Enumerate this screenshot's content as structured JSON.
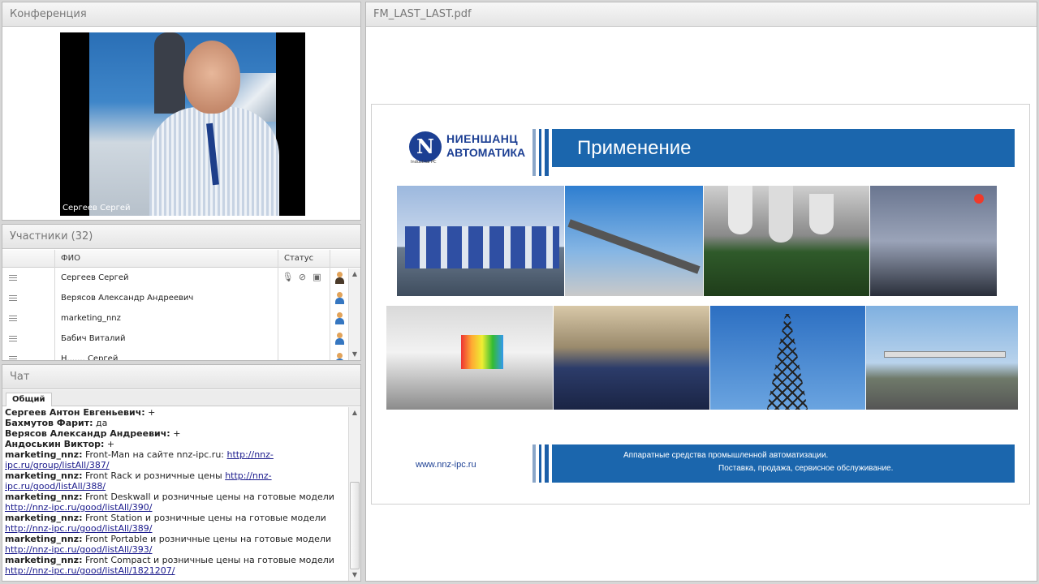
{
  "conference": {
    "title": "Конференция",
    "video_label": "Сергеев Сергей"
  },
  "participants": {
    "title": "Участники (32)",
    "col_name": "ФИО",
    "col_status": "Статус",
    "rows": [
      {
        "name": "Сергеев Сергей",
        "status_icons": [
          "mic-icon",
          "camera-icon",
          "screen-off-icon"
        ],
        "role_icon": "presenter-icon"
      },
      {
        "name": "Верясов Александр  Андреевич",
        "status_icons": [],
        "role_icon": "user-icon"
      },
      {
        "name": "marketing_nnz",
        "status_icons": [],
        "role_icon": "user-icon"
      },
      {
        "name": "Бабич Виталий",
        "status_icons": [],
        "role_icon": "user-icon"
      },
      {
        "name": "Н.......  Сергей",
        "status_icons": [],
        "role_icon": "user-icon"
      }
    ]
  },
  "chat": {
    "title": "Чат",
    "tab": "Общий",
    "messages": [
      {
        "author": "Сергеев Антон  Евгеньевич:",
        "text": " +",
        "link": ""
      },
      {
        "author": "Бахмутов Фарит:",
        "text": " да",
        "link": ""
      },
      {
        "author": "Верясов Александр  Андреевич:",
        "text": " +",
        "link": ""
      },
      {
        "author": "Андоськин Виктор:",
        "text": " +",
        "link": ""
      },
      {
        "author": "marketing_nnz:",
        "text": " Front-Man на сайте nnz-ipc.ru:  ",
        "link": "http://nnz-ipc.ru/group/listAll/387/"
      },
      {
        "author": "marketing_nnz:",
        "text": " Front Rack и розничные цены ",
        "link": "http://nnz-ipc.ru/good/listAll/388/"
      },
      {
        "author": "marketing_nnz:",
        "text": " Front Deskwall и розничные цены на готовые модели ",
        "link": "http://nnz-ipc.ru/good/listAll/390/"
      },
      {
        "author": "marketing_nnz:",
        "text": " Front Station и розничные цены на готовые модели ",
        "link": "http://nnz-ipc.ru/good/listAll/389/"
      },
      {
        "author": "marketing_nnz:",
        "text": " Front Portable и розничные цены на готовые модели ",
        "link": "http://nnz-ipc.ru/good/listAll/393/"
      },
      {
        "author": "marketing_nnz:",
        "text": " Front Compact и розничные цены на готовые модели ",
        "link": "http://nnz-ipc.ru/good/listAll/1821207/"
      }
    ]
  },
  "document": {
    "title": "FM_LAST_LAST.pdf",
    "slide": {
      "logo_line1": "НИЕНШАНЦ",
      "logo_line2": "АВТОМАТИКА",
      "logo_mark": "N",
      "logo_sub": "Industrial PC",
      "heading": "Применение",
      "website": "www.nnz-ipc.ru",
      "footer_line1": "Аппаратные средства промышленной автоматизации.",
      "footer_line2": "Поставка, продажа, сервисное обслуживание.",
      "photos": [
        "trucks",
        "monorail",
        "microscope-pcb",
        "railway-crossing",
        "control-room",
        "train-interior",
        "power-pylon",
        "highway-gantry"
      ]
    }
  },
  "colors": {
    "brand_blue": "#1b66ad",
    "logo_blue": "#1c3f93",
    "link": "#1a1a8c"
  }
}
